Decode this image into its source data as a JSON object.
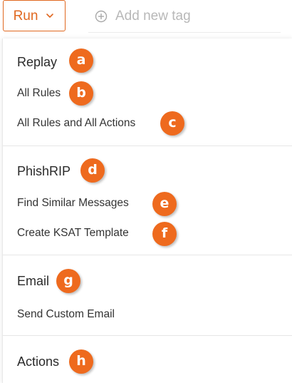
{
  "toolbar": {
    "run_label": "Run",
    "tag_placeholder": "Add new tag"
  },
  "menu": {
    "sections": [
      {
        "heading": "Replay",
        "heading_badge": "a",
        "items": [
          {
            "label": "All Rules",
            "badge": "b"
          },
          {
            "label": "All Rules and All Actions",
            "badge": "c"
          }
        ]
      },
      {
        "heading": "PhishRIP",
        "heading_badge": "d",
        "items": [
          {
            "label": "Find Similar Messages",
            "badge": "e"
          },
          {
            "label": "Create KSAT Template",
            "badge": "f"
          }
        ]
      },
      {
        "heading": "Email",
        "heading_badge": "g",
        "items": [
          {
            "label": "Send Custom Email"
          }
        ]
      },
      {
        "heading": "Actions",
        "heading_badge": "h",
        "items": []
      }
    ]
  },
  "colors": {
    "accent": "#e06820",
    "badge": "#ee6a1e"
  }
}
